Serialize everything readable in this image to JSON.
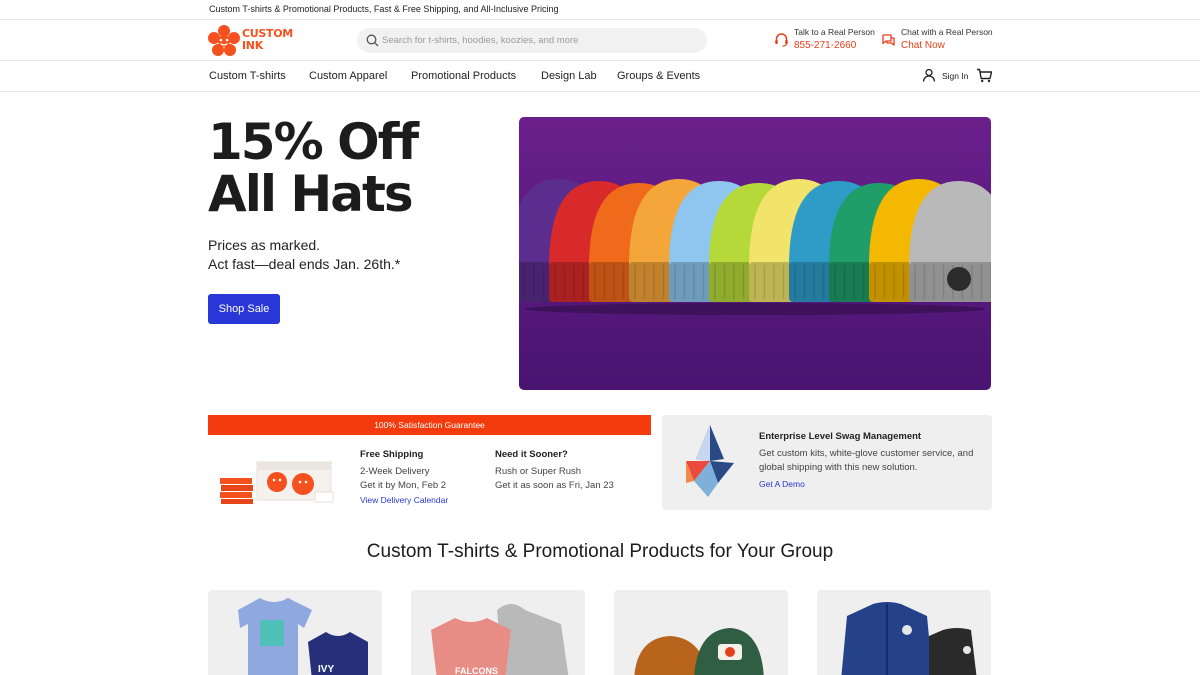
{
  "announcement": "Custom T-shirts & Promotional Products, Fast & Free Shipping, and All-Inclusive Pricing",
  "brand": {
    "logo_line1": "CUSTOM",
    "logo_line2": "INK",
    "accent": "#f4511e",
    "primary_blue": "#2a37d8"
  },
  "search": {
    "placeholder": "Search for t-shirts, hoodies, koozies, and more",
    "value": ""
  },
  "contact": {
    "phone": {
      "label": "Talk to a Real Person",
      "value": "855-271-2660",
      "icon": "headset-icon"
    },
    "chat": {
      "label": "Chat with a Real Person",
      "value": "Chat Now",
      "icon": "chat-icon"
    }
  },
  "nav": {
    "items": [
      "Custom T-shirts",
      "Custom Apparel",
      "Promotional Products",
      "Design Lab",
      "Groups & Events"
    ],
    "sign_in": "Sign In"
  },
  "hero": {
    "title_line1": "15% Off",
    "title_line2": "All Hats",
    "sub_line1": "Prices as marked.",
    "sub_line2": "Act fast—deal ends Jan. 26th.*",
    "button": "Shop Sale",
    "beanie_colors": [
      "#5b2d8e",
      "#d82a2a",
      "#f06a1c",
      "#f4a63a",
      "#8ec6ef",
      "#b6d93a",
      "#f2e46b",
      "#2f9cc8",
      "#1f9e6a",
      "#f5b800",
      "#b9b9b9"
    ]
  },
  "shipping": {
    "guarantee": "100% Satisfaction Guarantee",
    "free": {
      "title": "Free Shipping",
      "line1": "2-Week Delivery",
      "line2": "Get it by Mon, Feb 2",
      "link": "View Delivery Calendar"
    },
    "sooner": {
      "title": "Need it Sooner?",
      "line1": "Rush or Super Rush",
      "line2": "Get it as soon as Fri, Jan 23"
    }
  },
  "enterprise": {
    "title": "Enterprise Level Swag Management",
    "description": "Get custom kits, white-glove customer service, and global shipping with this new solution.",
    "link": "Get A Demo"
  },
  "section": {
    "title": "Custom T-shirts & Promotional Products for Your Group",
    "tiles": [
      "t-shirts",
      "hoodies",
      "hats",
      "jackets"
    ]
  }
}
